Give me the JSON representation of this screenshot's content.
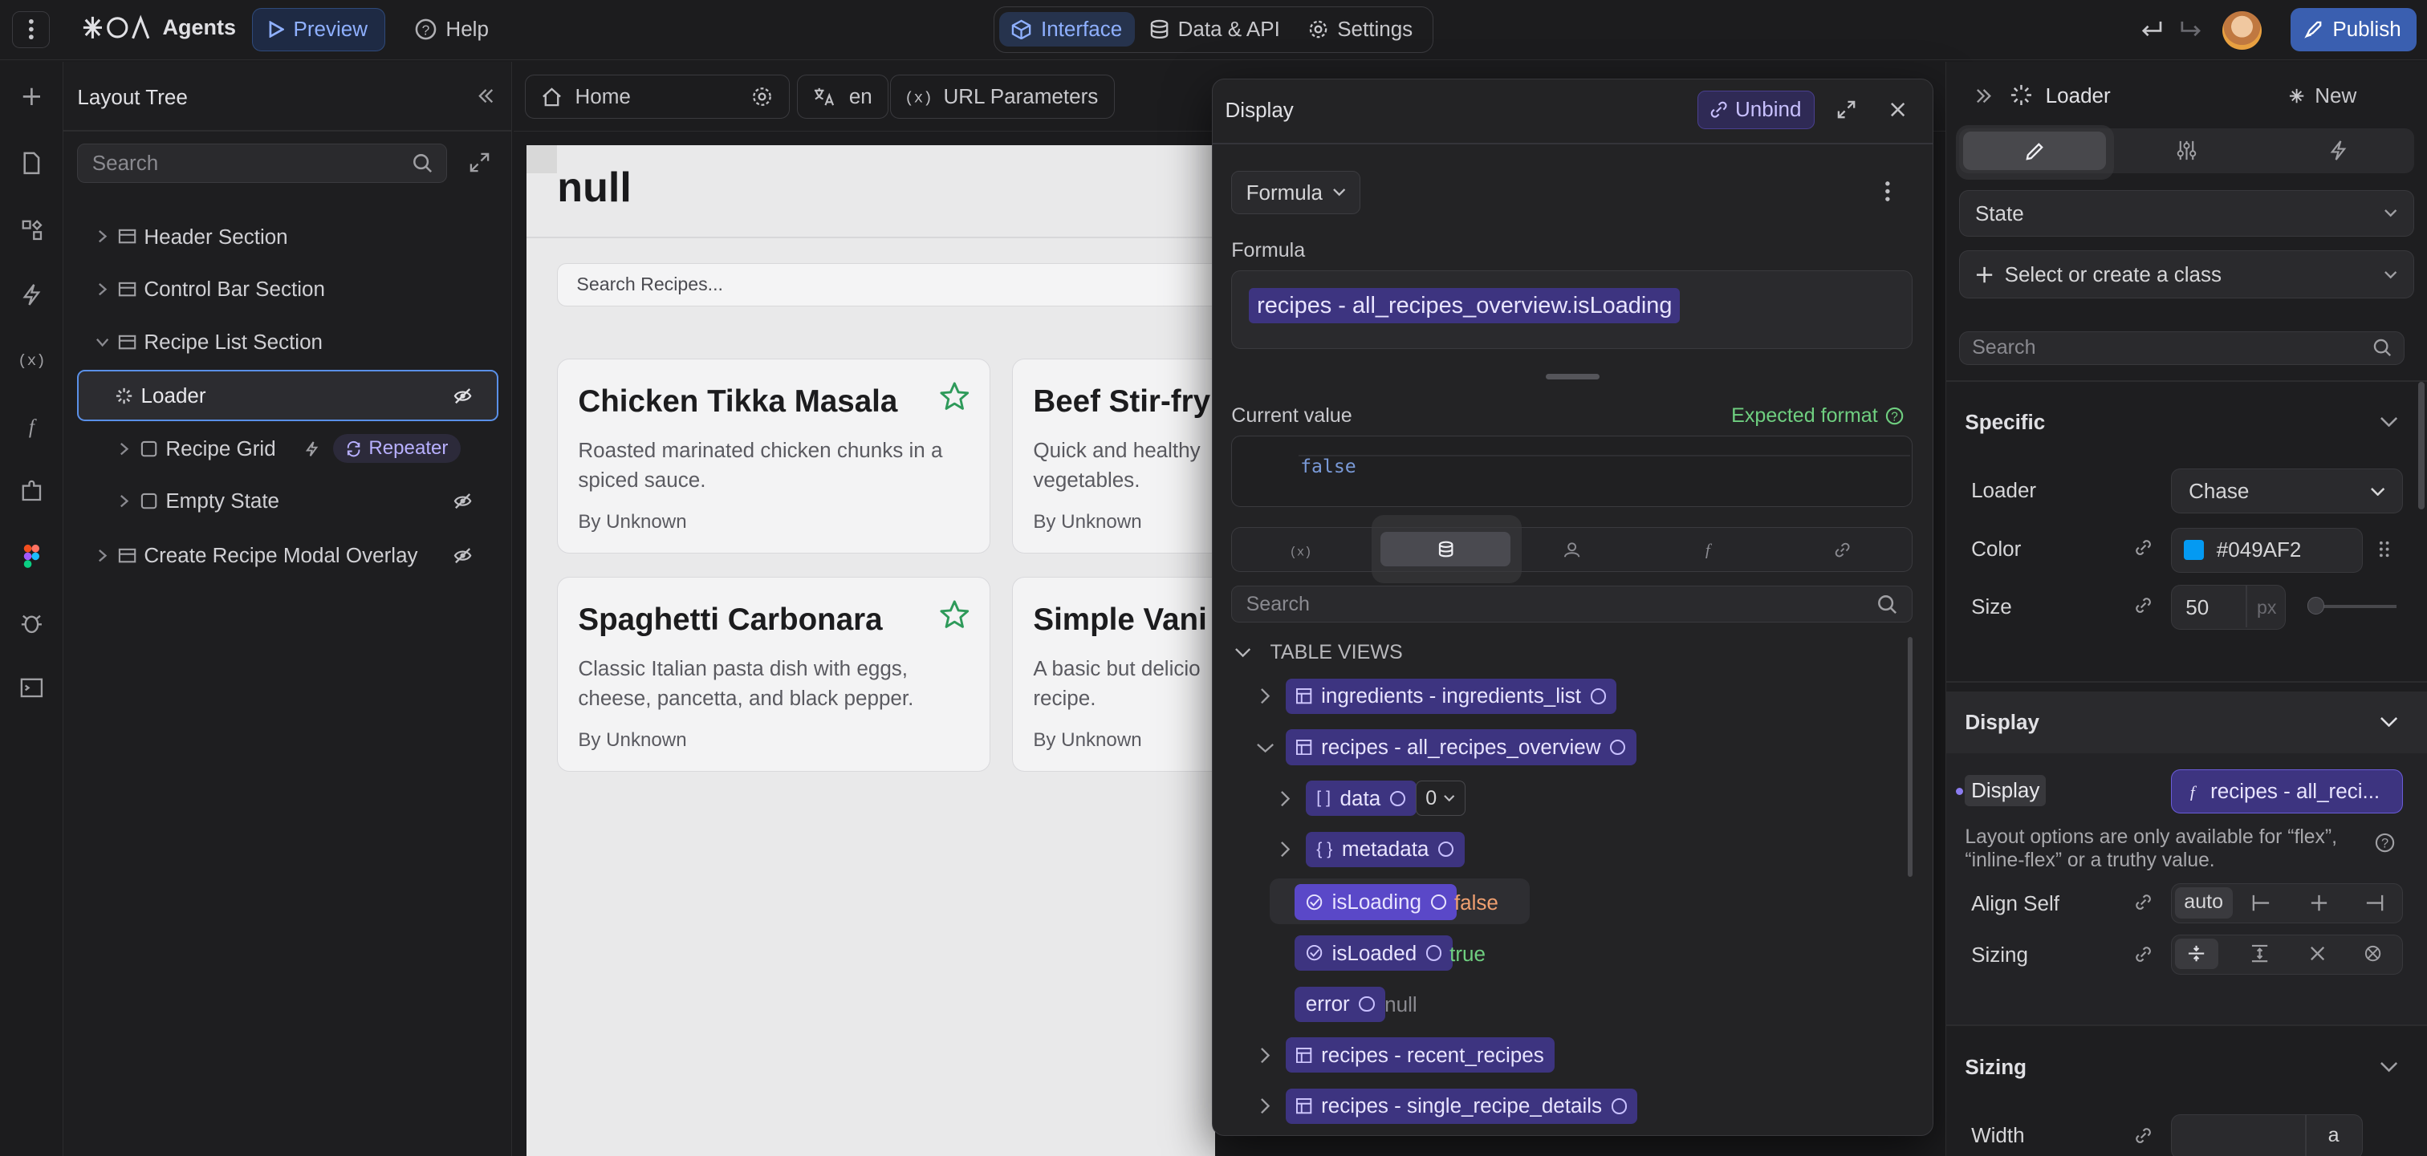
{
  "topbar": {
    "brand": "Agents",
    "preview": "Preview",
    "help": "Help",
    "tabs": [
      "Interface",
      "Data & API",
      "Settings"
    ],
    "publish": "Publish"
  },
  "tree": {
    "title": "Layout Tree",
    "search_placeholder": "Search",
    "items": [
      {
        "label": "Header Section"
      },
      {
        "label": "Control Bar Section"
      },
      {
        "label": "Recipe List Section"
      },
      {
        "label": "Loader"
      },
      {
        "label": "Recipe Grid",
        "badge": "Repeater"
      },
      {
        "label": "Empty State"
      },
      {
        "label": "Create Recipe Modal Overlay"
      }
    ]
  },
  "canvasbar": {
    "home": "Home",
    "lang": "en",
    "url_params": "URL Parameters"
  },
  "canvas": {
    "heading": "null",
    "search_placeholder": "Search Recipes...",
    "cards": [
      {
        "title": "Chicken Tikka Masala",
        "desc": "Roasted marinated chicken chunks in a spiced sauce.",
        "by": "By Unknown"
      },
      {
        "title": "Beef Stir-fry",
        "desc": "Quick and healthy vegetables.",
        "by": "By Unknown"
      },
      {
        "title": "Spaghetti Carbonara",
        "desc": "Classic Italian pasta dish with eggs, cheese, pancetta, and black pepper.",
        "by": "By Unknown"
      },
      {
        "title": "Simple Vani",
        "desc": "A basic but delicio recipe.",
        "by": "By Unknown"
      }
    ]
  },
  "popup": {
    "title": "Display",
    "unbind": "Unbind",
    "mode": "Formula",
    "formula_label": "Formula",
    "formula": "recipes - all_recipes_overview.isLoading",
    "current_value_label": "Current value",
    "expected_format": "Expected format",
    "current_value": "false",
    "search_placeholder": "Search",
    "section": "TABLE VIEWS",
    "tree": {
      "ingredients": "ingredients - ingredients_list",
      "overview": "recipes - all_recipes_overview",
      "data": "data",
      "data_index": "0",
      "metadata": "metadata",
      "isLoading": "isLoading",
      "isLoading_val": "false",
      "isLoaded": "isLoaded",
      "isLoaded_val": "true",
      "error": "error",
      "error_val": "null",
      "recent": "recipes - recent_recipes",
      "single": "recipes - single_recipe_details"
    }
  },
  "right": {
    "title": "Loader",
    "new": "New",
    "state": "State",
    "class_placeholder": "Select or create a class",
    "search_placeholder": "Search",
    "specific": "Specific",
    "loader_label": "Loader",
    "loader_value": "Chase",
    "color_label": "Color",
    "color_value": "#049AF2",
    "size_label": "Size",
    "size_value": "50",
    "size_unit": "px",
    "display_section": "Display",
    "display_label": "Display",
    "display_value": "recipes - all_reci...",
    "layout_note": "Layout options are only available for “flex”, “inline-flex” or a truthy value.",
    "align_self_label": "Align Self",
    "align_self_value": "auto",
    "sizing_label": "Sizing",
    "sizing_section": "Sizing",
    "width_label": "Width",
    "width_unit": "a"
  },
  "colors": {
    "accent": "#7c6cf0",
    "publish": "#3a5fb0",
    "loader_color": "#049AF2",
    "chip": "#3d3480",
    "false": "#f0a070",
    "true": "#6fcf80"
  }
}
